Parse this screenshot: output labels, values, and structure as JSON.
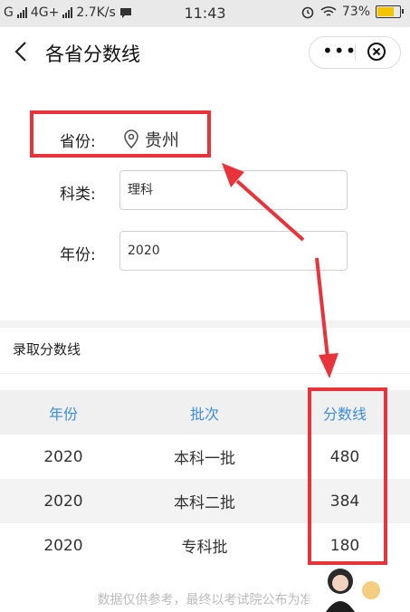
{
  "status_bar": {
    "carrier": "G",
    "network": "4G+",
    "speed": "2.7K/s",
    "time": "11:43",
    "battery": "73%"
  },
  "nav": {
    "title": "各省分数线"
  },
  "form": {
    "province_label": "省份:",
    "province_value": "贵州",
    "subject_label": "科类:",
    "subject_value": "理科",
    "year_label": "年份:",
    "year_value": "2020"
  },
  "section": {
    "title": "录取分数线"
  },
  "table": {
    "headers": [
      "年份",
      "批次",
      "分数线"
    ],
    "rows": [
      [
        "2020",
        "本科一批",
        "480"
      ],
      [
        "2020",
        "本科二批",
        "384"
      ],
      [
        "2020",
        "专科批",
        "180"
      ]
    ]
  },
  "footer": {
    "note": "数据仅供参考，最终以考试院公布为准"
  },
  "colors": {
    "accent": "#3b8de0",
    "highlight": "#e8333b"
  }
}
